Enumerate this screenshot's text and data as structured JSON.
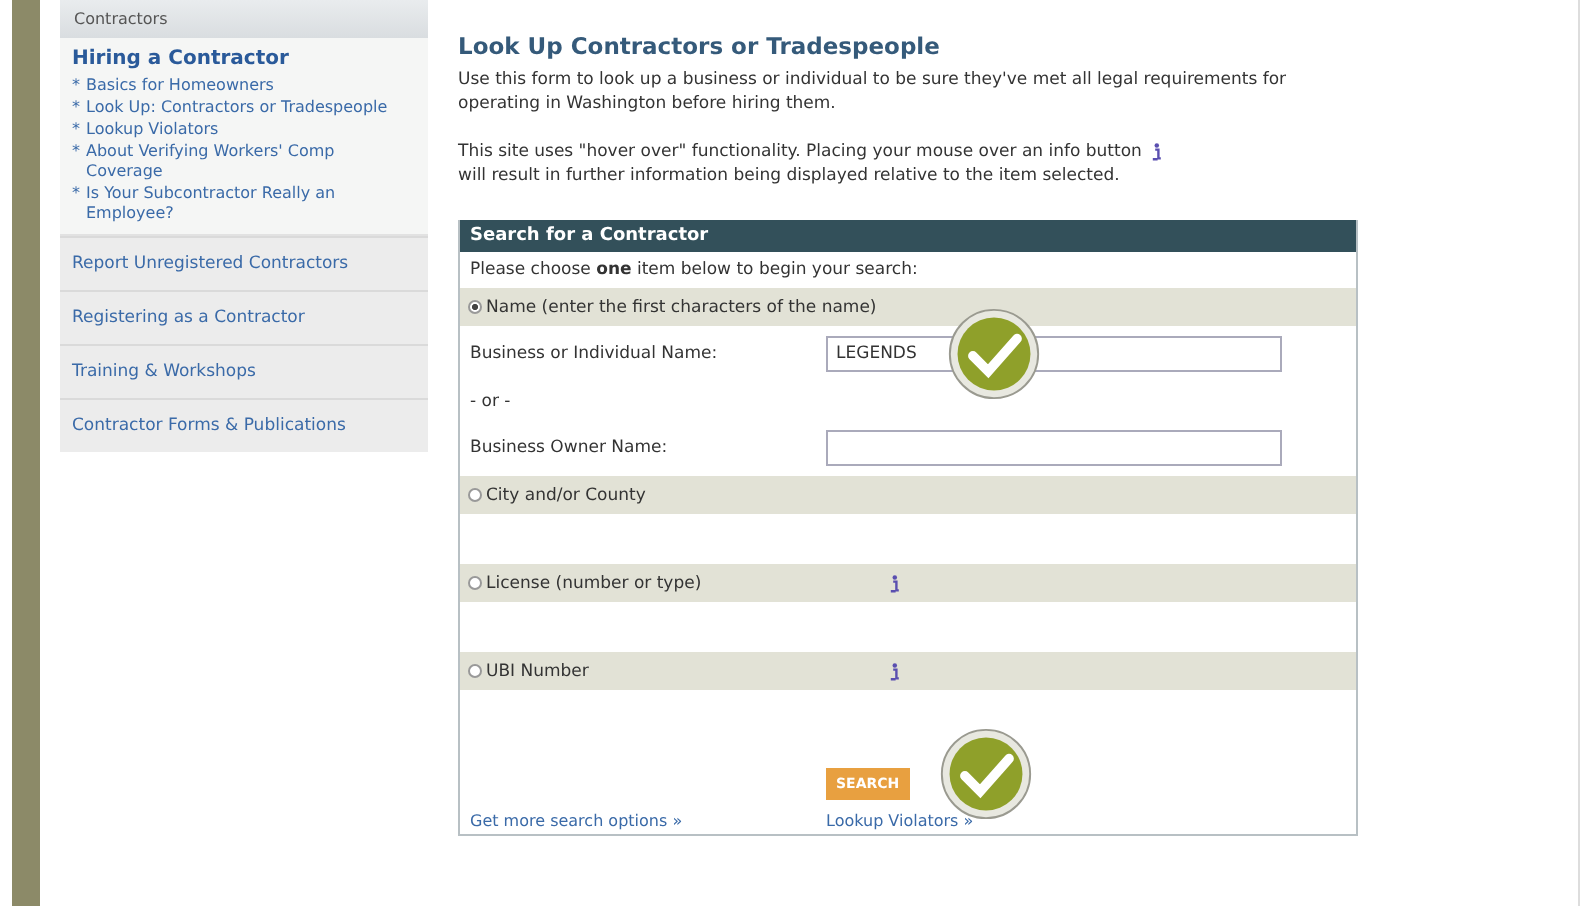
{
  "sidebar": {
    "header": "Contractors",
    "section_title": "Hiring a Contractor",
    "bullet": "*",
    "links": [
      "Basics for Homeowners",
      "Look Up: Contractors or Tradespeople",
      "Lookup Violators",
      "About Verifying Workers' Comp Coverage",
      "Is Your Subcontractor Really an Employee?"
    ],
    "nav_items": [
      "Report Unregistered Contractors",
      "Registering as a Contractor",
      "Training & Workshops",
      "Contractor Forms & Publications"
    ]
  },
  "main": {
    "title": "Look Up Contractors or Tradespeople",
    "intro": "Use this form to look up a business or individual to be sure they've met all legal requirements for operating in Washington before hiring them.",
    "hover_note_before": "This site uses \"hover over\" functionality. Placing your mouse over an info button",
    "hover_note_after": "will result in further information being displayed relative to the item selected.",
    "search_panel": {
      "title": "Search for a Contractor",
      "instruction": "Please choose **one** item below to begin your search:",
      "rows": [
        {
          "kind": "radio",
          "label": "Name (enter the first characters of the name)",
          "selected": true,
          "info": false
        },
        {
          "kind": "field",
          "label": "Business or Individual Name:",
          "value": "LEGENDS",
          "check_badge": true
        },
        {
          "kind": "separator",
          "label": "- or -"
        },
        {
          "kind": "field",
          "label": "Business Owner Name:",
          "check_badge": false
        },
        {
          "kind": "radio",
          "label": "City and/or County",
          "selected": false,
          "info": false
        },
        {
          "kind": "radio",
          "label": "License (number or type)",
          "selected": false,
          "info": true
        },
        {
          "kind": "radio",
          "label": "UBI Number",
          "selected": false,
          "info": true
        }
      ],
      "search_button": {
        "label": "SEARCH",
        "check_badge": true
      },
      "links": [
        "Get more search options »",
        "Lookup Violators »"
      ]
    }
  }
}
